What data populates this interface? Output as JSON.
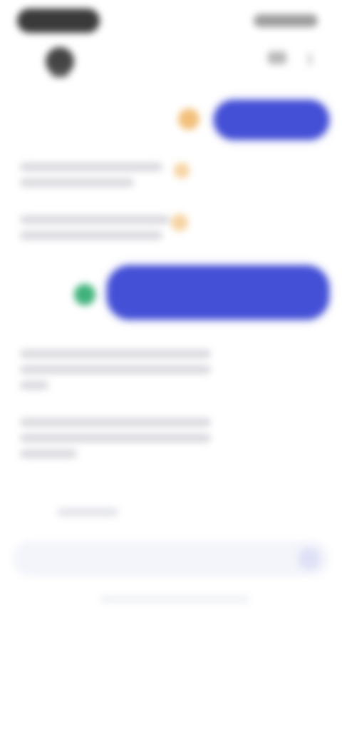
{
  "status_bar": {
    "time": "",
    "indicators": ""
  },
  "header": {
    "contact_name": "",
    "call_label": "",
    "menu_label": ""
  },
  "messages": [
    {
      "role": "user",
      "emoji": "",
      "text": ""
    },
    {
      "role": "assistant",
      "text": "",
      "meta": ""
    },
    {
      "role": "assistant",
      "text": "",
      "emoji": ""
    },
    {
      "role": "user",
      "emoji": "",
      "text": ""
    },
    {
      "role": "assistant",
      "text": "",
      "meta": ""
    },
    {
      "role": "assistant",
      "text": ""
    }
  ],
  "suggestion": {
    "label": ""
  },
  "composer": {
    "placeholder": "",
    "value": ""
  },
  "footer": {
    "note": ""
  },
  "colors": {
    "accent": "#4450d6",
    "bubble_text": "#ffffff",
    "emoji_orange": "#f2c07a",
    "emoji_green": "#3fb27a",
    "composer_bg": "#f4f5fb"
  }
}
